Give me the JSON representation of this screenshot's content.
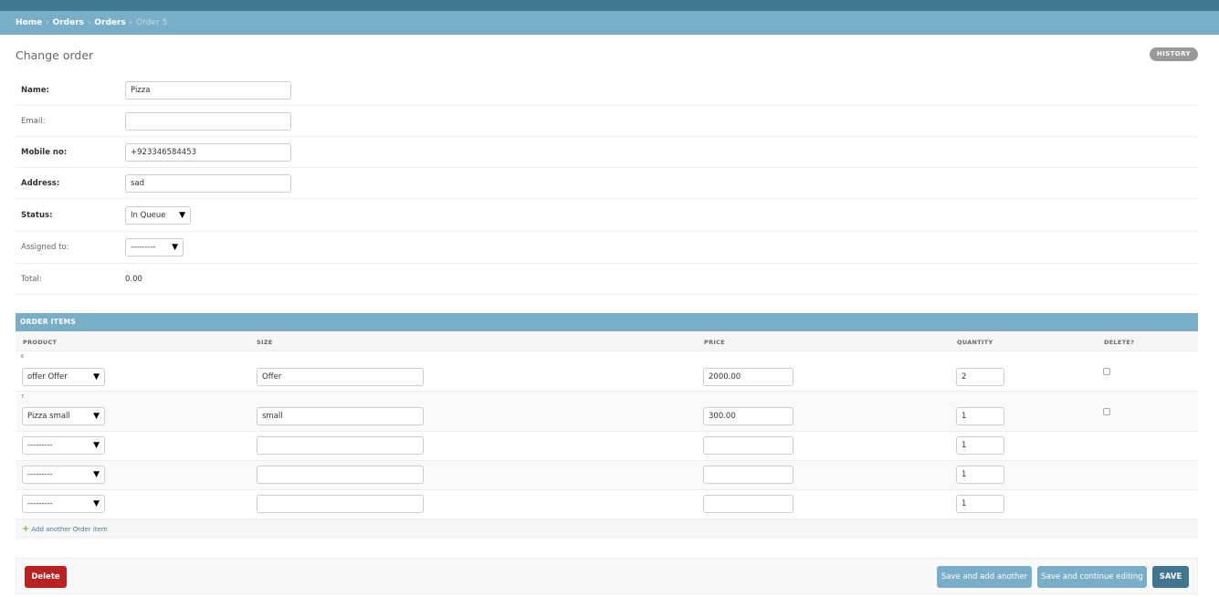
{
  "breadcrumbs": {
    "home": "Home",
    "app": "Orders",
    "model": "Orders",
    "current": "Order 5",
    "sep": "›"
  },
  "page": {
    "title": "Change order",
    "history": "HISTORY"
  },
  "fields": {
    "name": {
      "label": "Name:",
      "value": "Pizza"
    },
    "email": {
      "label": "Email:",
      "value": ""
    },
    "mobile": {
      "label": "Mobile no:",
      "value": "+923346584453"
    },
    "address": {
      "label": "Address:",
      "value": "sad"
    },
    "status": {
      "label": "Status:",
      "value": "In Queue"
    },
    "assigned": {
      "label": "Assigned to:",
      "value": "---------"
    },
    "total": {
      "label": "Total:",
      "value": "0.00"
    }
  },
  "inline": {
    "title": "ORDER ITEMS",
    "columns": {
      "product": "PRODUCT",
      "size": "SIZE",
      "price": "PRICE",
      "quantity": "QUANTITY",
      "delete": "DELETE?"
    },
    "rows": [
      {
        "orig": "6",
        "product": "offer Offer",
        "size": "Offer",
        "price": "2000.00",
        "quantity": "2"
      },
      {
        "orig": "7",
        "product": "Pizza small",
        "size": "small",
        "price": "300.00",
        "quantity": "1"
      },
      {
        "orig": "",
        "product": "---------",
        "size": "",
        "price": "",
        "quantity": "1"
      },
      {
        "orig": "",
        "product": "---------",
        "size": "",
        "price": "",
        "quantity": "1"
      },
      {
        "orig": "",
        "product": "---------",
        "size": "",
        "price": "",
        "quantity": "1"
      }
    ],
    "add_label": "Add another Order item"
  },
  "actions": {
    "delete": "Delete",
    "save_add": "Save and add another",
    "save_continue": "Save and continue editing",
    "save": "SAVE"
  },
  "icons": {
    "dropdown": "triangle-down-icon",
    "add": "plus-icon"
  }
}
